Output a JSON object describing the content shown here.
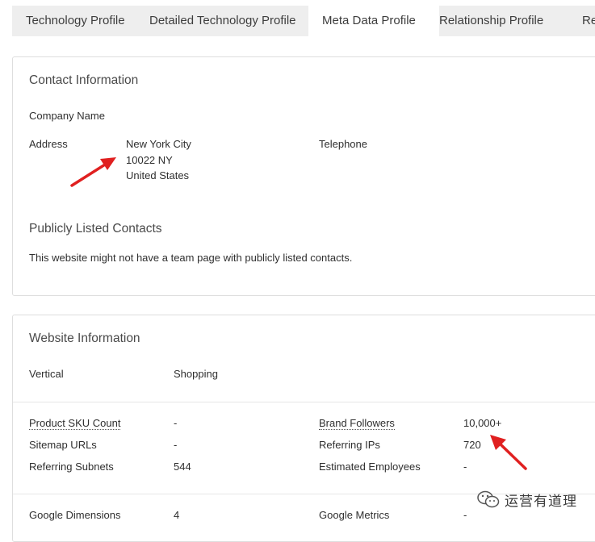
{
  "tabs": [
    {
      "label": "Technology Profile",
      "active": false
    },
    {
      "label": "Detailed Technology Profile",
      "active": false
    },
    {
      "label": "Meta Data Profile",
      "active": true
    },
    {
      "label": "Relationship Profile",
      "active": false
    },
    {
      "label": "Redirect",
      "active": false
    }
  ],
  "contact": {
    "title": "Contact Information",
    "company_name_label": "Company Name",
    "address_label": "Address",
    "address_lines": [
      "New York City",
      "10022 NY",
      "United States"
    ],
    "telephone_label": "Telephone",
    "public_contacts_title": "Publicly Listed Contacts",
    "public_contacts_text": "This website might not have a team page with publicly listed contacts."
  },
  "website": {
    "title": "Website Information",
    "vertical_label": "Vertical",
    "vertical_value": "Shopping",
    "metrics_left": [
      {
        "label": "Product SKU Count",
        "value": "-",
        "dotted": true
      },
      {
        "label": "Sitemap URLs",
        "value": "-",
        "dotted": false
      },
      {
        "label": "Referring Subnets",
        "value": "544",
        "dotted": false
      }
    ],
    "metrics_right": [
      {
        "label": "Brand Followers",
        "value": "10,000+",
        "dotted": true
      },
      {
        "label": "Referring IPs",
        "value": "720",
        "dotted": false
      },
      {
        "label": "Estimated Employees",
        "value": "-",
        "dotted": false
      }
    ],
    "google_dimensions_label": "Google Dimensions",
    "google_dimensions_value": "4",
    "google_metrics_label": "Google Metrics",
    "google_metrics_value": "-"
  },
  "watermark": {
    "text": "运营有道理",
    "icon": "wechat-icon"
  },
  "colors": {
    "annotation_arrow": "#e02020",
    "active_tab": "#ffffff",
    "tabbar": "#eeeeee"
  }
}
